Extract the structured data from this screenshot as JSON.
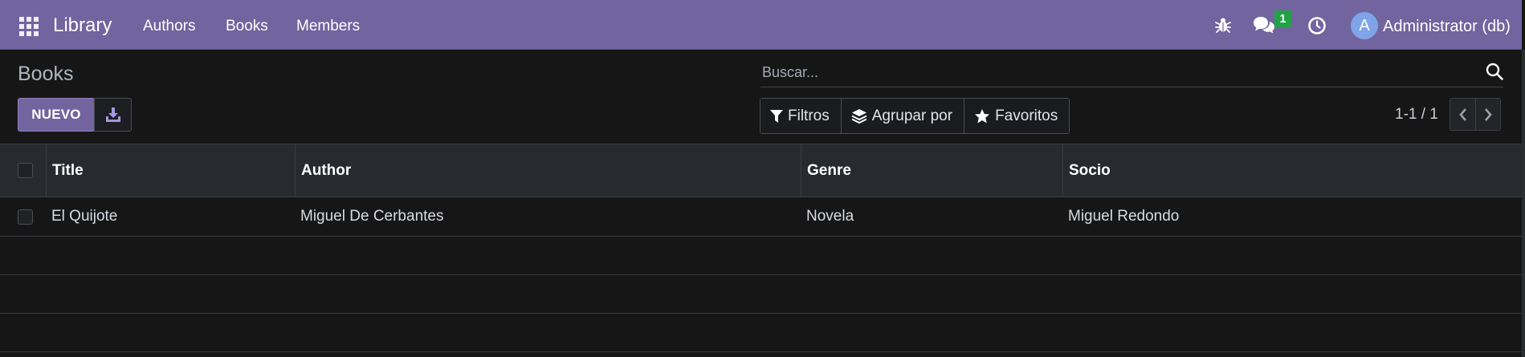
{
  "navbar": {
    "app_name": "Library",
    "menu": [
      "Authors",
      "Books",
      "Members"
    ],
    "messages_badge": "1",
    "user_initial": "A",
    "user_name": "Administrator (db)",
    "icons": [
      "apps-grid-icon",
      "bug-icon",
      "chat-icon",
      "clock-icon"
    ]
  },
  "control_panel": {
    "title": "Books",
    "new_button": "NUEVO",
    "search_placeholder": "Buscar...",
    "filters": [
      "Filtros",
      "Agrupar por",
      "Favoritos"
    ],
    "pager": "1-1 / 1"
  },
  "table": {
    "columns": [
      "Title",
      "Author",
      "Genre",
      "Socio"
    ],
    "rows": [
      {
        "title": "El Quijote",
        "author": "Miguel De Cerbantes",
        "genre": "Novela",
        "socio": "Miguel Redondo"
      }
    ]
  },
  "colors": {
    "navbar": "#72649f",
    "background": "#161616",
    "badge": "#21a345",
    "avatar": "#7fa4e8"
  }
}
